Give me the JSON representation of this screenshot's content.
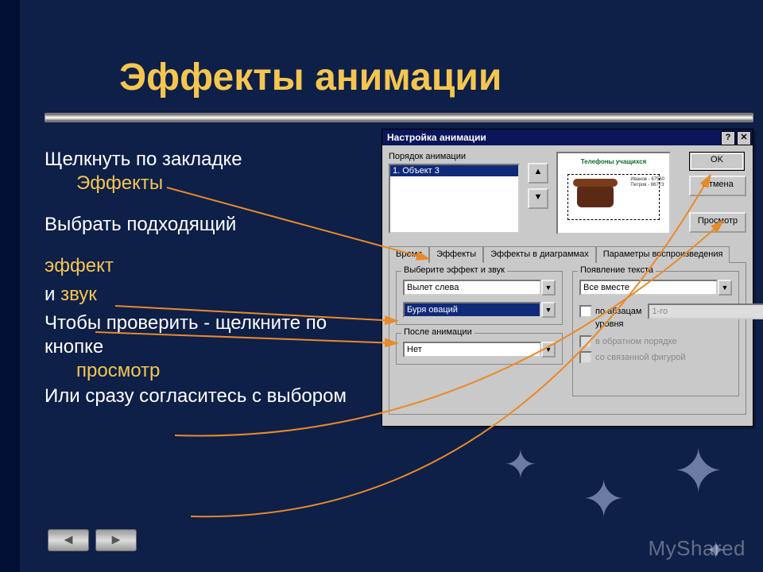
{
  "slide": {
    "title": "Эффекты анимации",
    "line1_a": "Щелкнуть по закладке",
    "line1_b": "Эффекты",
    "line2": "Выбрать подходящий",
    "line3": "эффект",
    "line4_a": "и ",
    "line4_b": "звук",
    "line5": "Чтобы проверить - щелкните по кнопке",
    "line5_b": "просмотр",
    "line6": "Или сразу согласитесь с выбором",
    "watermark": "MyShared"
  },
  "dialog": {
    "title": "Настройка анимации",
    "help_btn": "?",
    "close_btn": "✕",
    "order_label": "Порядок анимации",
    "order_item": "1. Объект 3",
    "up": "▲",
    "down": "▼",
    "preview_title": "Телефоны учащихся",
    "preview_l1": "Иванов - 67560",
    "preview_l2": "Петров - 86773",
    "btn_ok": "OK",
    "btn_cancel": "Отмена",
    "btn_preview": "Просмотр",
    "tabs": {
      "t1": "Время",
      "t2": "Эффекты",
      "t3": "Эффекты в диаграммах",
      "t4": "Параметры воспроизведения"
    },
    "group_effect": "Выберите эффект и звук",
    "effect_value": "Вылет слева",
    "sound_value": "Буря оваций",
    "group_after": "После анимации",
    "after_value": "Нет",
    "group_text": "Появление текста",
    "text_value": "Все вместе",
    "chk_para": "по абзацам",
    "para_level": "1-го",
    "para_level2": "уровня",
    "chk_reverse": "в обратном порядке",
    "chk_shape": "со связанной фигурой"
  }
}
